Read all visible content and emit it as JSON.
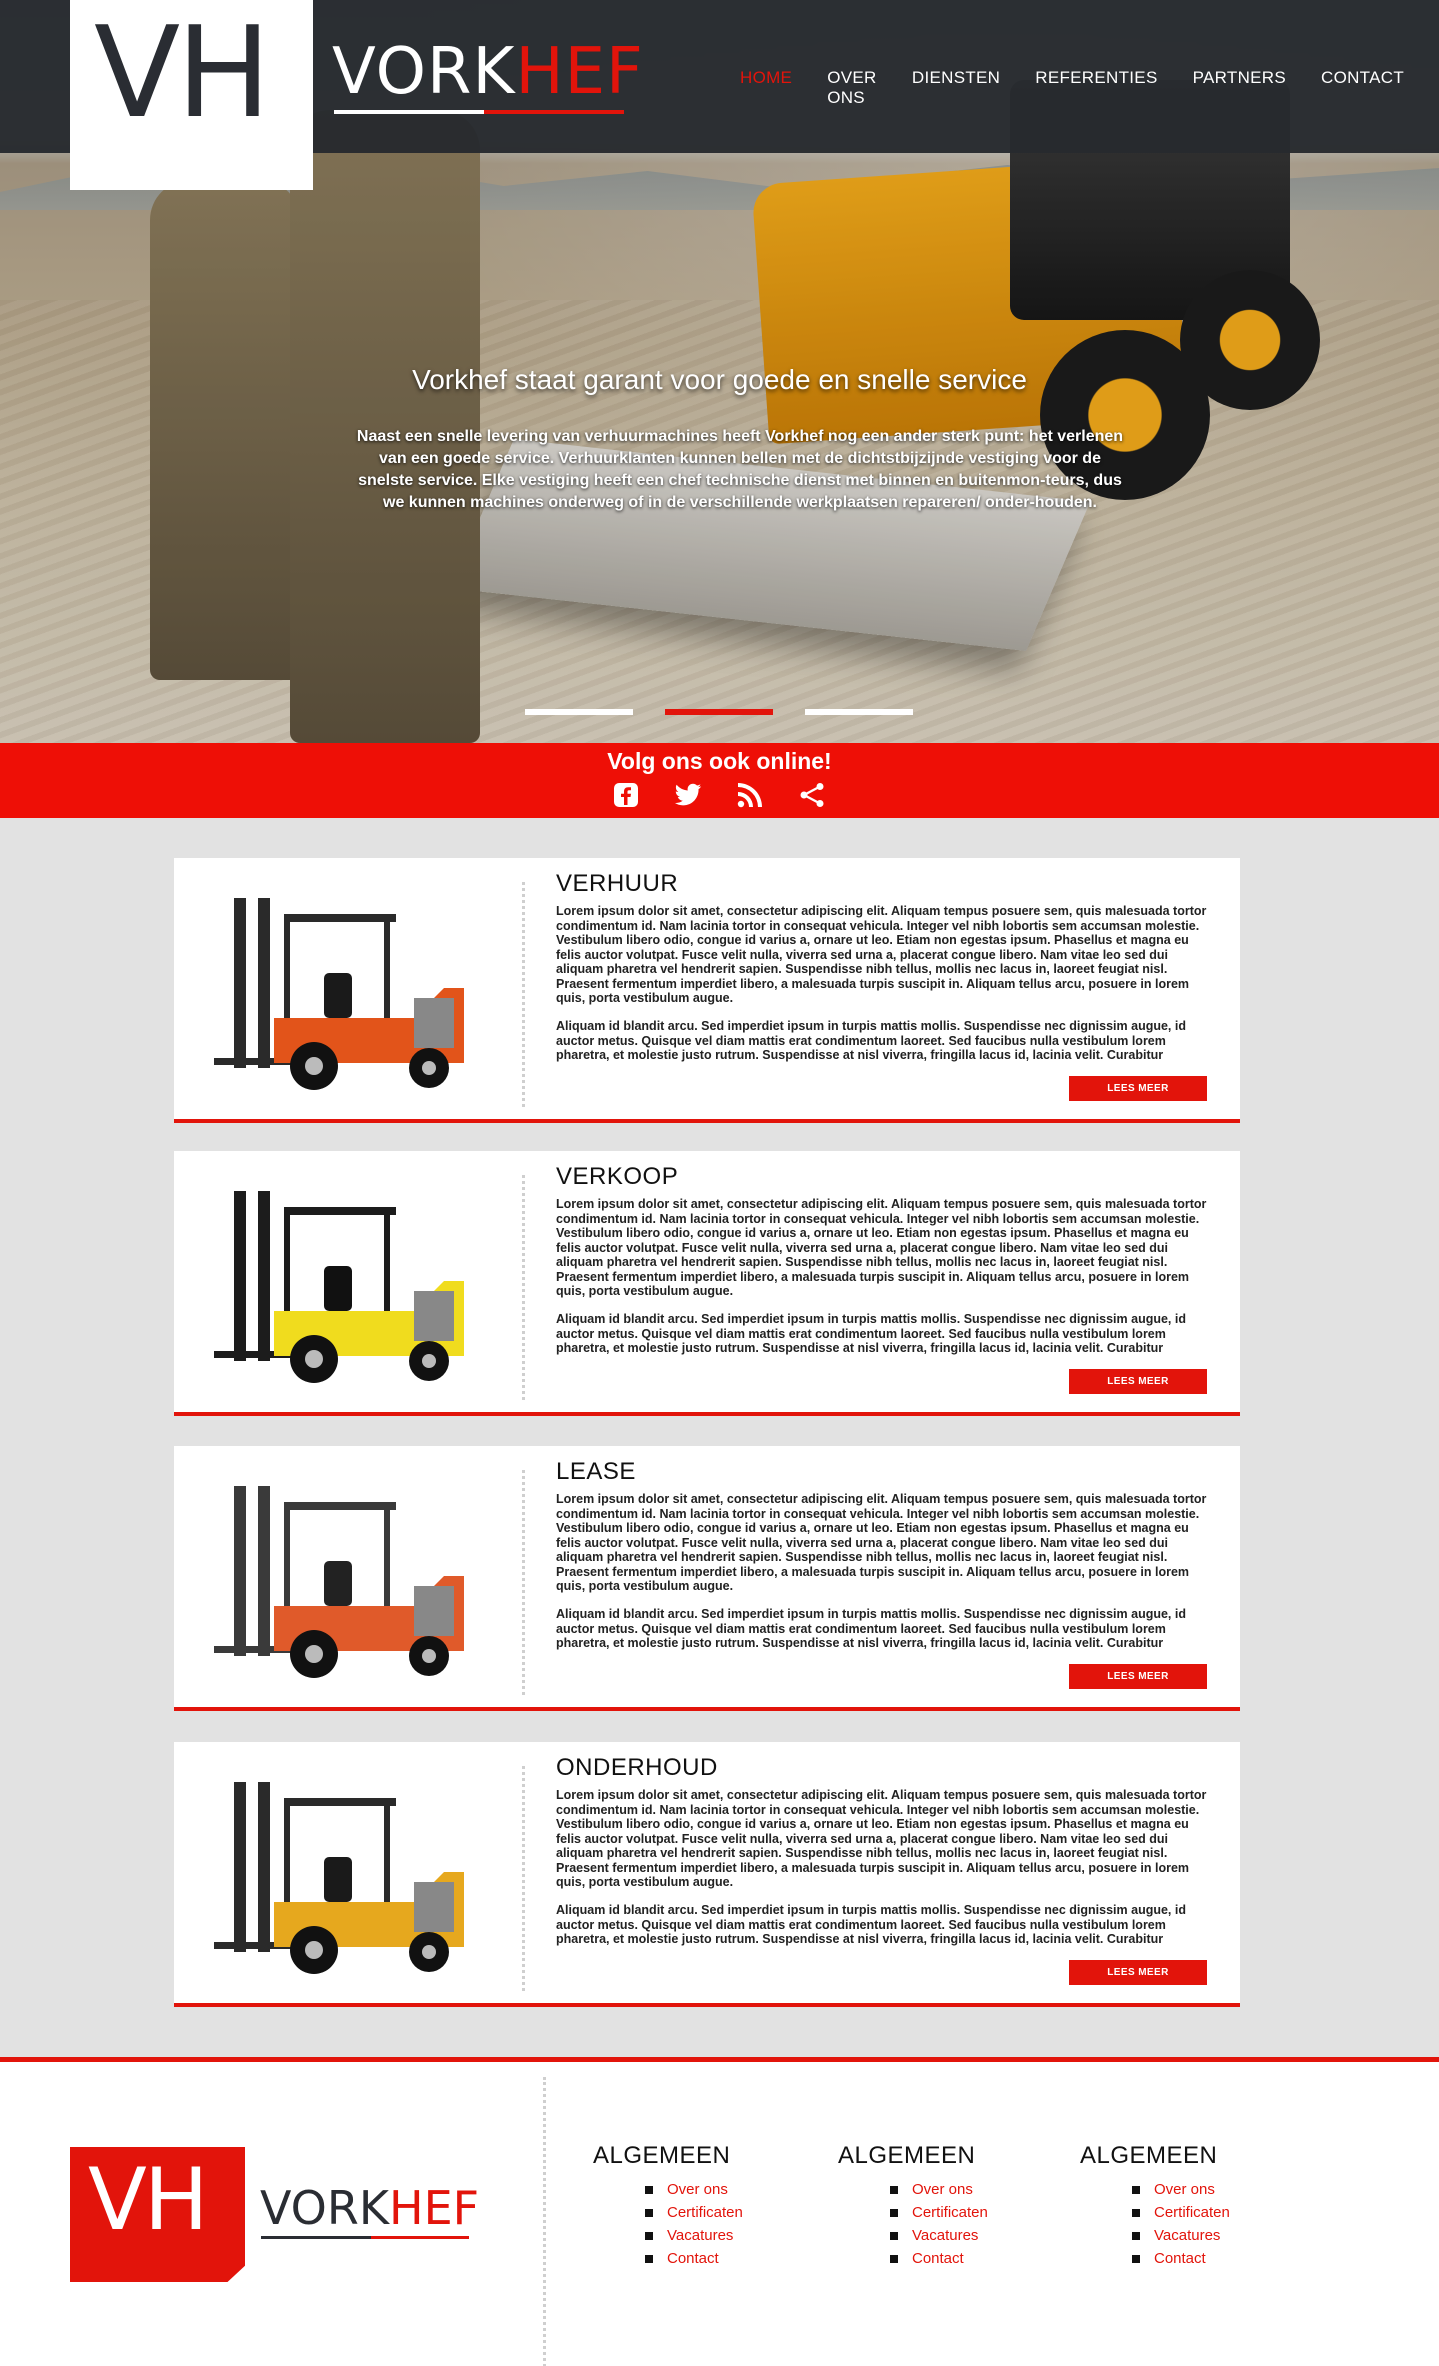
{
  "nav": {
    "logo_mark": "VH",
    "brand_white": "VORK",
    "brand_red": "HEF",
    "items": [
      "HOME",
      "OVER ONS",
      "DIENSTEN",
      "REFERENTIES",
      "PARTNERS",
      "CONTACT"
    ],
    "active": "HOME"
  },
  "hero": {
    "title": "Vorkhef staat garant voor goede en snelle service",
    "text": "Naast een snelle levering van verhuurmachines heeft Vorkhef nog een ander sterk punt: het verlenen van een goede service. Verhuurklanten kunnen bellen met de dichtstbijzijnde vestiging voor de snelste service. Elke vestiging heeft een chef technische dienst met binnen en buitenmon-teurs, dus we kunnen machines onderweg of in de verschillende werkplaatsen repareren/ onder-houden.",
    "slides": 3,
    "active_slide": 2
  },
  "social": {
    "title": "Volg ons ook online!",
    "icons": [
      "facebook-icon",
      "twitter-icon",
      "rss-icon",
      "share-icon"
    ]
  },
  "cards": [
    {
      "title": "VERHUUR",
      "p1": "Lorem ipsum dolor sit amet, consectetur adipiscing elit. Aliquam tempus posuere sem, quis malesuada tortor condimentum id. Nam lacinia tortor in consequat vehicula. Integer vel nibh lobortis sem accumsan molestie. Vestibulum libero odio, congue id varius a, ornare ut leo. Etiam non egestas ipsum. Phasellus et magna eu felis auctor volutpat. Fusce velit nulla, viverra sed urna a, placerat congue libero. Nam vitae leo sed dui aliquam pharetra vel hendrerit sapien. Suspendisse nibh tellus, mollis nec lacus in, laoreet feugiat nisl. Praesent fermentum imperdiet libero, a malesuada turpis suscipit in. Aliquam tellus arcu, posuere in lorem quis, porta vestibulum augue.",
      "p2": "Aliquam id blandit arcu. Sed imperdiet ipsum in turpis mattis mollis. Suspendisse nec dignissim augue, id auctor metus. Quisque vel diam mattis erat condimentum laoreet. Sed faucibus nulla vestibulum lorem pharetra, et molestie justo rutrum. Suspendisse at nisl viverra, fringilla lacus id, lacinia velit. Curabitur",
      "button": "LEES MEER",
      "forklift": {
        "body": "#e2541a",
        "mast": "#2a2a2a",
        "seat": "#1a1a1a"
      }
    },
    {
      "title": "VERKOOP",
      "p1": "Lorem ipsum dolor sit amet, consectetur adipiscing elit. Aliquam tempus posuere sem, quis malesuada tortor condimentum id. Nam lacinia tortor in consequat vehicula. Integer vel nibh lobortis sem accumsan molestie. Vestibulum libero odio, congue id varius a, ornare ut leo. Etiam non egestas ipsum. Phasellus et magna eu felis auctor volutpat. Fusce velit nulla, viverra sed urna a, placerat congue libero. Nam vitae leo sed dui aliquam pharetra vel hendrerit sapien. Suspendisse nibh tellus, mollis nec lacus in, laoreet feugiat nisl. Praesent fermentum imperdiet libero, a malesuada turpis suscipit in. Aliquam tellus arcu, posuere in lorem quis, porta vestibulum augue.",
      "p2": "Aliquam id blandit arcu. Sed imperdiet ipsum in turpis mattis mollis. Suspendisse nec dignissim augue, id auctor metus. Quisque vel diam mattis erat condimentum laoreet. Sed faucibus nulla vestibulum lorem pharetra, et molestie justo rutrum. Suspendisse at nisl viverra, fringilla lacus id, lacinia velit. Curabitur",
      "button": "LEES MEER",
      "forklift": {
        "body": "#f0dc1e",
        "mast": "#1c1c1c",
        "seat": "#111111"
      }
    },
    {
      "title": "LEASE",
      "p1": "Lorem ipsum dolor sit amet, consectetur adipiscing elit. Aliquam tempus posuere sem, quis malesuada tortor condimentum id. Nam lacinia tortor in consequat vehicula. Integer vel nibh lobortis sem accumsan molestie. Vestibulum libero odio, congue id varius a, ornare ut leo. Etiam non egestas ipsum. Phasellus et magna eu felis auctor volutpat. Fusce velit nulla, viverra sed urna a, placerat congue libero. Nam vitae leo sed dui aliquam pharetra vel hendrerit sapien. Suspendisse nibh tellus, mollis nec lacus in, laoreet feugiat nisl. Praesent fermentum imperdiet libero, a malesuada turpis suscipit in. Aliquam tellus arcu, posuere in lorem quis, porta vestibulum augue.",
      "p2": "Aliquam id blandit arcu. Sed imperdiet ipsum in turpis mattis mollis. Suspendisse nec dignissim augue, id auctor metus. Quisque vel diam mattis erat condimentum laoreet. Sed faucibus nulla vestibulum lorem pharetra, et molestie justo rutrum. Suspendisse at nisl viverra, fringilla lacus id, lacinia velit. Curabitur",
      "button": "LEES MEER",
      "forklift": {
        "body": "#e05a2a",
        "mast": "#3a3a3a",
        "seat": "#222222"
      }
    },
    {
      "title": "ONDERHOUD",
      "p1": "Lorem ipsum dolor sit amet, consectetur adipiscing elit. Aliquam tempus posuere sem, quis malesuada tortor condimentum id. Nam lacinia tortor in consequat vehicula. Integer vel nibh lobortis sem accumsan molestie. Vestibulum libero odio, congue id varius a, ornare ut leo. Etiam non egestas ipsum. Phasellus et magna eu felis auctor volutpat. Fusce velit nulla, viverra sed urna a, placerat congue libero. Nam vitae leo sed dui aliquam pharetra vel hendrerit sapien. Suspendisse nibh tellus, mollis nec lacus in, laoreet feugiat nisl. Praesent fermentum imperdiet libero, a malesuada turpis suscipit in. Aliquam tellus arcu, posuere in lorem quis, porta vestibulum augue.",
      "p2": "Aliquam id blandit arcu. Sed imperdiet ipsum in turpis mattis mollis. Suspendisse nec dignissim augue, id auctor metus. Quisque vel diam mattis erat condimentum laoreet. Sed faucibus nulla vestibulum lorem pharetra, et molestie justo rutrum. Suspendisse at nisl viverra, fringilla lacus id, lacinia velit. Curabitur",
      "button": "LEES MEER",
      "forklift": {
        "body": "#e6a81e",
        "mast": "#2a2a2a",
        "seat": "#1a1a1a"
      }
    }
  ],
  "footer": {
    "logo_mark": "VH",
    "brand_dark": "VORK",
    "brand_red": "HEF",
    "columns": [
      {
        "title": "ALGEMEEN",
        "links": [
          "Over ons",
          "Certificaten",
          "Vacatures",
          "Contact"
        ]
      },
      {
        "title": "ALGEMEEN",
        "links": [
          "Over ons",
          "Certificaten",
          "Vacatures",
          "Contact"
        ]
      },
      {
        "title": "ALGEMEEN",
        "links": [
          "Over ons",
          "Certificaten",
          "Vacatures",
          "Contact"
        ]
      }
    ]
  },
  "colors": {
    "accent": "#e2140b",
    "nav_bg": "#272a2e",
    "page_bg": "#e2e2e2"
  }
}
